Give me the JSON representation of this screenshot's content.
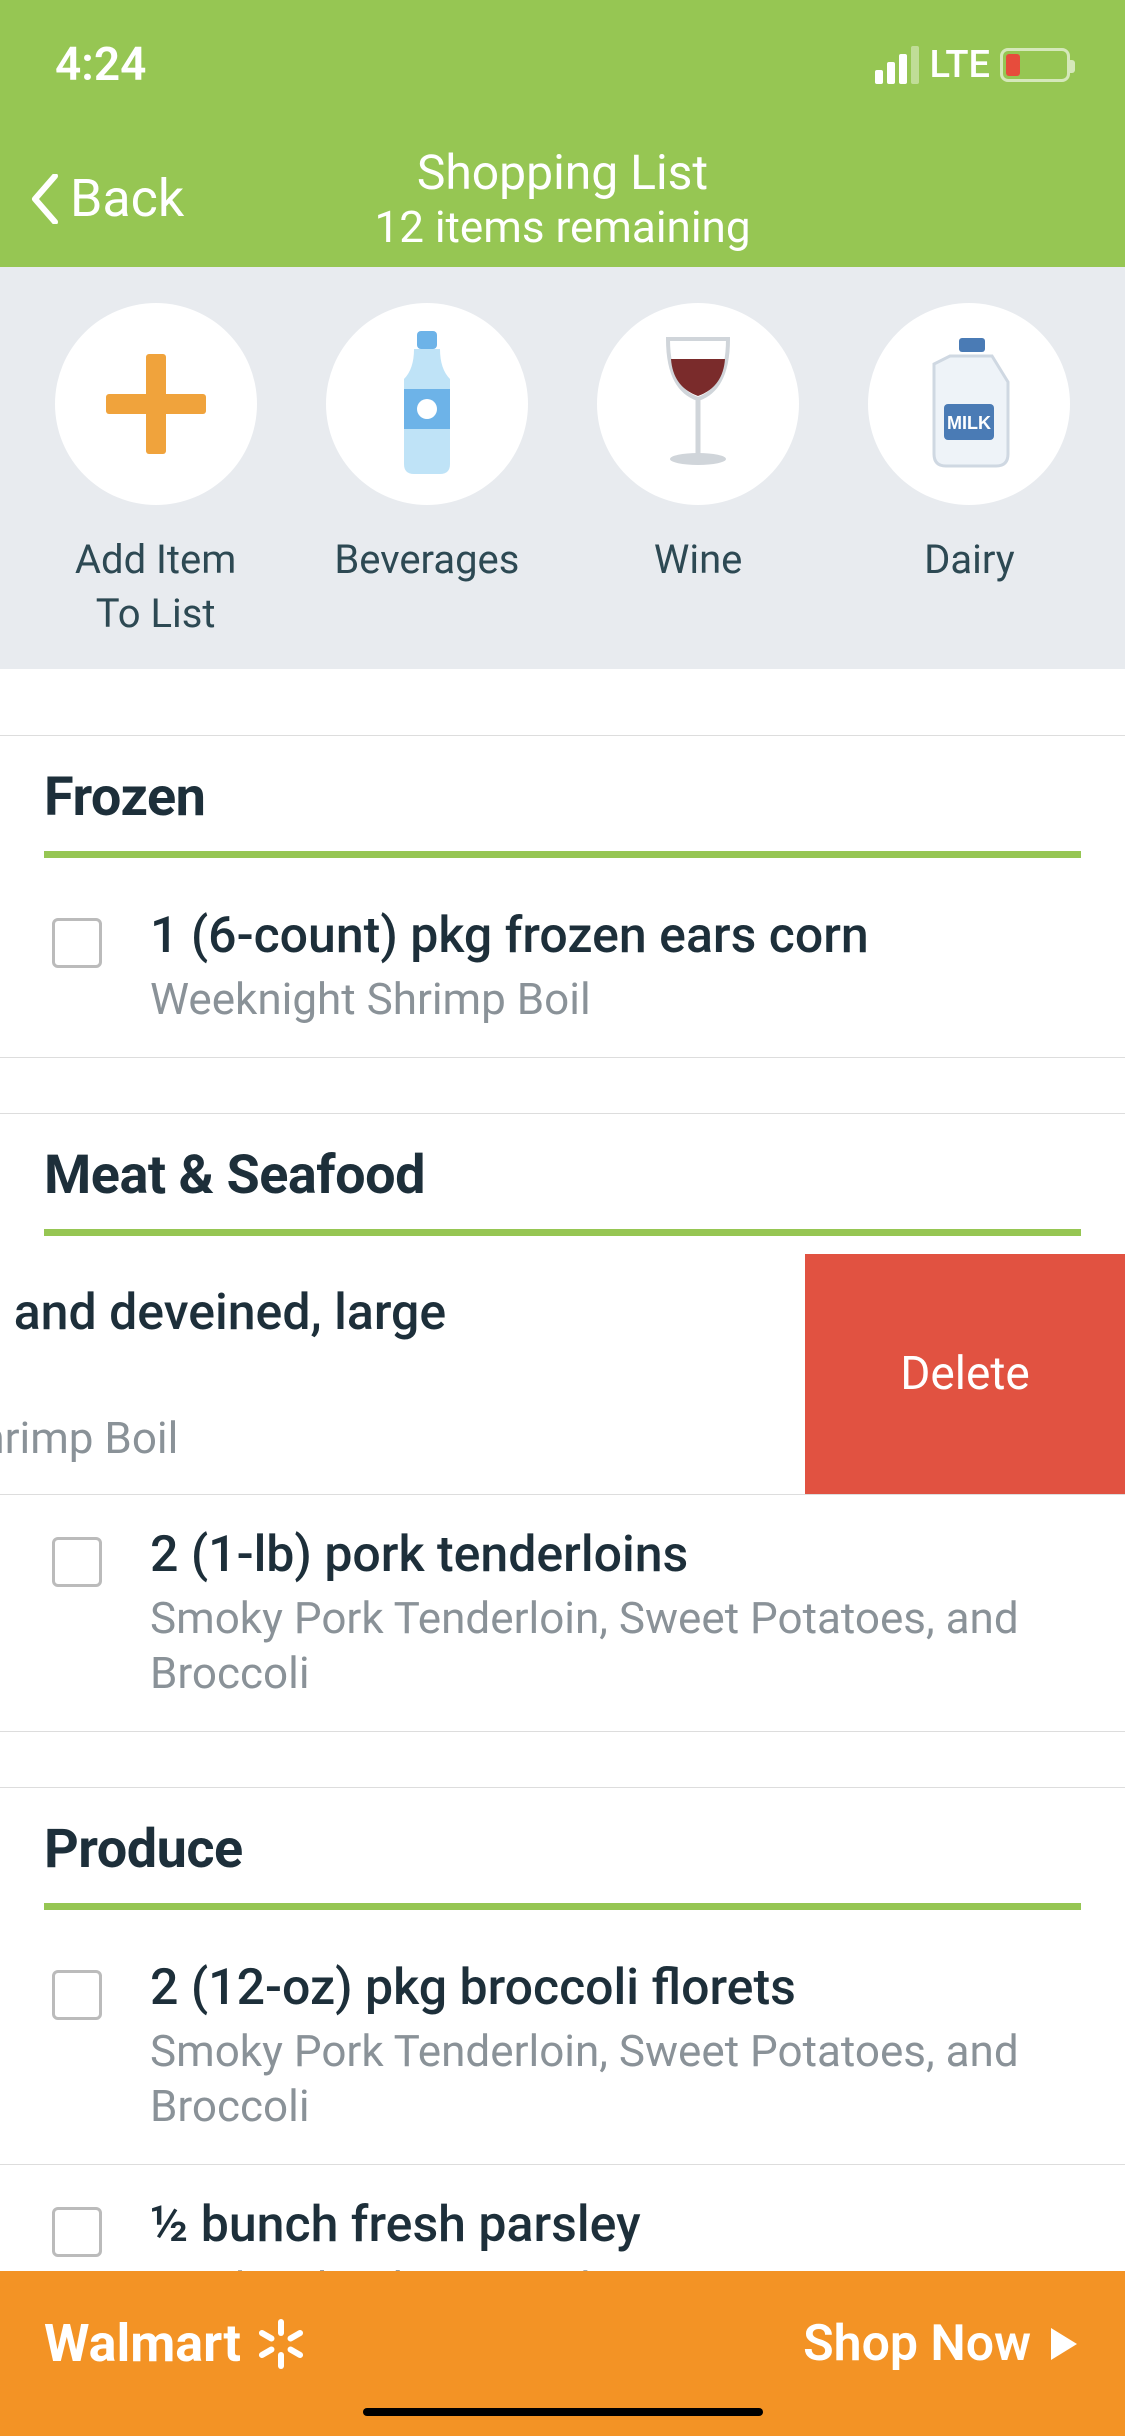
{
  "statusBar": {
    "time": "4:24",
    "network": "LTE"
  },
  "header": {
    "back": "Back",
    "title": "Shopping List",
    "subtitle": "12 items remaining"
  },
  "categories": [
    {
      "label": "Add Item\nTo List",
      "icon": "plus"
    },
    {
      "label": "Beverages",
      "icon": "bottle"
    },
    {
      "label": "Wine",
      "icon": "wine"
    },
    {
      "label": "Dairy",
      "icon": "milk"
    }
  ],
  "sections": [
    {
      "title": "Frozen",
      "items": [
        {
          "title": "1 (6-count) pkg frozen ears corn",
          "subtitle": "Weeknight Shrimp Boil"
        }
      ]
    },
    {
      "title": "Meat & Seafood",
      "items": [
        {
          "title": "eeled and deveined, large rimp",
          "subtitle": "ght Shrimp Boil",
          "swiped": true,
          "deleteLabel": "Delete"
        },
        {
          "title": "2 (1-lb) pork tenderloins",
          "subtitle": "Smoky Pork Tenderloin, Sweet Potatoes, and Broccoli"
        }
      ]
    },
    {
      "title": "Produce",
      "items": [
        {
          "title": "2 (12-oz) pkg broccoli florets",
          "subtitle": "Smoky Pork Tenderloin, Sweet Potatoes, and Broccoli"
        },
        {
          "title": "½ bunch fresh parsley",
          "subtitle": "Weeknight Shrimp Boil"
        }
      ]
    }
  ],
  "footer": {
    "brand": "Walmart",
    "cta": "Shop Now"
  }
}
